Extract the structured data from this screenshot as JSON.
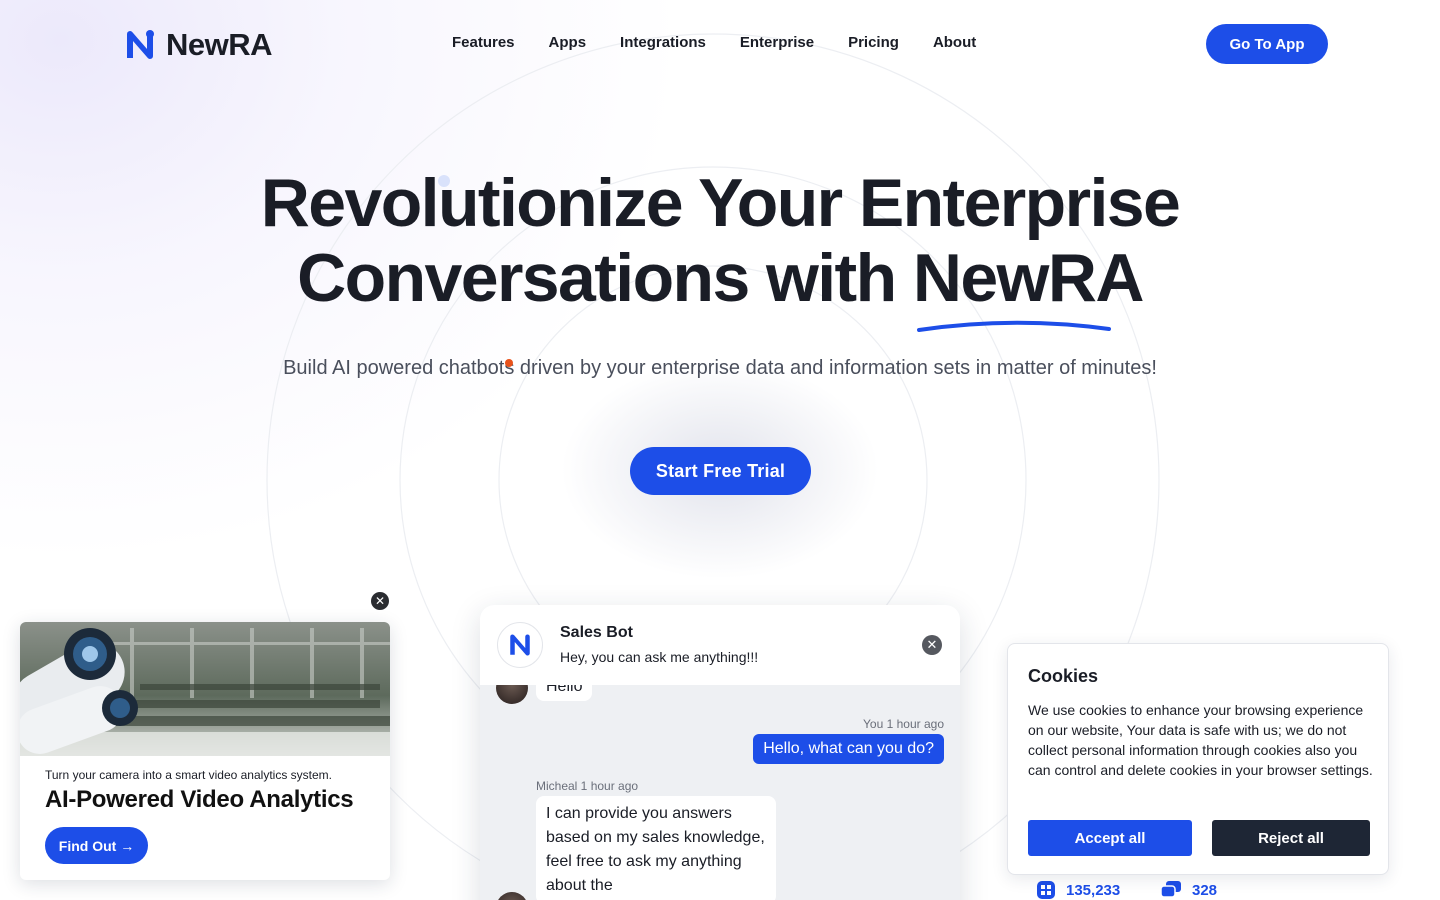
{
  "brand": {
    "name": "NewRA",
    "accent": "#1d4ee8"
  },
  "nav": {
    "items": [
      "Features",
      "Apps",
      "Integrations",
      "Enterprise",
      "Pricing",
      "About"
    ],
    "cta": "Go To App"
  },
  "hero": {
    "title_line1": "Revolutionize Your Enterprise",
    "title_line2": "Conversations with NewRA",
    "subtitle": "Build AI powered chatbots driven by your enterprise data and information sets in matter of minutes!",
    "cta": "Start Free Trial"
  },
  "chat": {
    "bot_name": "Sales Bot",
    "bot_tagline": "Hey, you can ask me anything!!!",
    "messages": [
      {
        "from": "user",
        "text": "Hello"
      },
      {
        "from": "you",
        "meta": "You 1 hour ago",
        "text": "Hello, what can you do?"
      },
      {
        "from": "bot",
        "meta": "Micheal 1 hour ago",
        "text": "I can provide you answers based on my sales knowledge, feel free to ask my anything about the"
      }
    ]
  },
  "promo": {
    "kicker": "Turn your camera into a smart video analytics system.",
    "title": "AI-Powered Video Analytics",
    "button": "Find Out →"
  },
  "stats": {
    "first": "135,233",
    "second": "328"
  },
  "cookies": {
    "title": "Cookies",
    "body": "We use cookies to enhance your browsing experience on our website, Your data is safe with us; we do not collect personal information through cookies also you can control and delete cookies in your browser settings.",
    "accept": "Accept all",
    "reject": "Reject all"
  },
  "icons": {
    "logo": "newra-logo-icon",
    "chat_close": "close-icon",
    "promo_close": "close-icon",
    "stat1": "grid-icon",
    "stat2": "chat-bubbles-icon"
  }
}
